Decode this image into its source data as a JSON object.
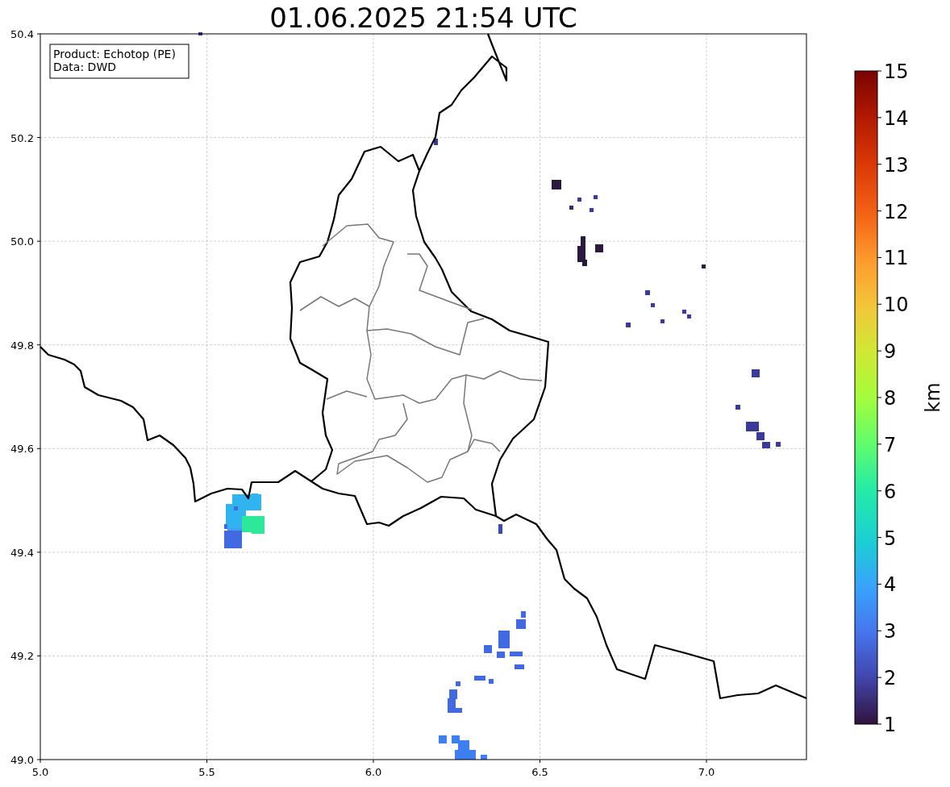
{
  "title": "01.06.2025 21:54 UTC",
  "info_box": [
    "Product: Echotop (PE)",
    "Data: DWD"
  ],
  "x_ticks": [
    "5.0",
    "5.5",
    "6.0",
    "6.5",
    "7.0"
  ],
  "y_ticks": [
    "50.4",
    "50.2",
    "50.0",
    "49.8",
    "49.6",
    "49.4",
    "49.2",
    "49.0"
  ],
  "colorbar": {
    "label": "km",
    "ticks": [
      "15",
      "14",
      "13",
      "12",
      "11",
      "10",
      "9",
      "8",
      "7",
      "6",
      "5",
      "4",
      "3",
      "2",
      "1"
    ]
  }
}
